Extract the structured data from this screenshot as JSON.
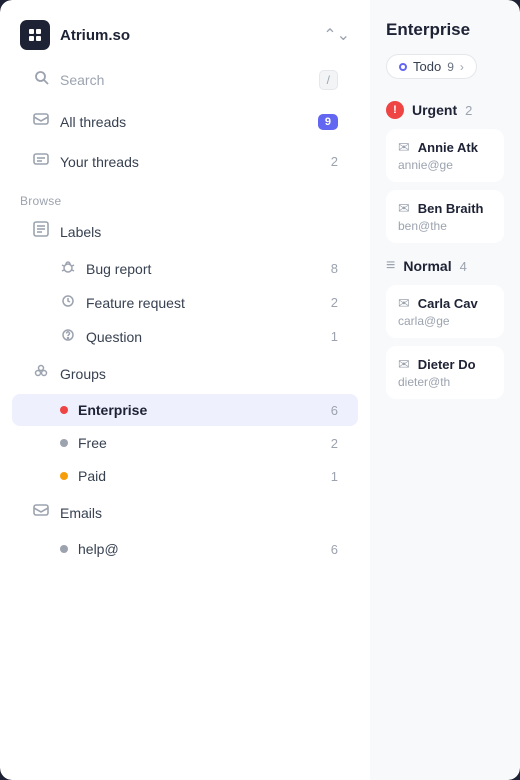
{
  "app": {
    "name": "Atrium.so",
    "logo_char": "◆"
  },
  "search": {
    "label": "Search",
    "shortcut": "/"
  },
  "nav": {
    "all_threads": {
      "label": "All threads",
      "badge": "9"
    },
    "your_threads": {
      "label": "Your threads",
      "count": "2"
    }
  },
  "browse": {
    "section_label": "Browse",
    "labels": {
      "label": "Labels",
      "items": [
        {
          "name": "Bug report",
          "count": "8",
          "icon": "bug"
        },
        {
          "name": "Feature request",
          "count": "2",
          "icon": "feature"
        },
        {
          "name": "Question",
          "count": "1",
          "icon": "question"
        }
      ]
    },
    "groups": {
      "label": "Groups",
      "items": [
        {
          "name": "Enterprise",
          "count": "6",
          "dot": "enterprise",
          "active": true
        },
        {
          "name": "Free",
          "count": "2",
          "dot": "free",
          "active": false
        },
        {
          "name": "Paid",
          "count": "1",
          "dot": "paid",
          "active": false
        }
      ]
    },
    "emails": {
      "label": "Emails",
      "items": [
        {
          "name": "help@",
          "count": "6"
        }
      ]
    }
  },
  "right_panel": {
    "title": "Enterprise",
    "todo_tab": "Todo",
    "todo_count": "9",
    "priorities": [
      {
        "type": "urgent",
        "label": "Urgent",
        "count": "2"
      }
    ],
    "threads": [
      {
        "name": "Annie Atk",
        "email": "annie@ge"
      },
      {
        "name": "Ben Braith",
        "email": "ben@the"
      }
    ],
    "normal": {
      "label": "Normal",
      "count": "4"
    },
    "normal_threads": [
      {
        "name": "Carla Cav",
        "email": "carla@ge"
      },
      {
        "name": "Dieter Do",
        "email": "dieter@th"
      }
    ]
  }
}
